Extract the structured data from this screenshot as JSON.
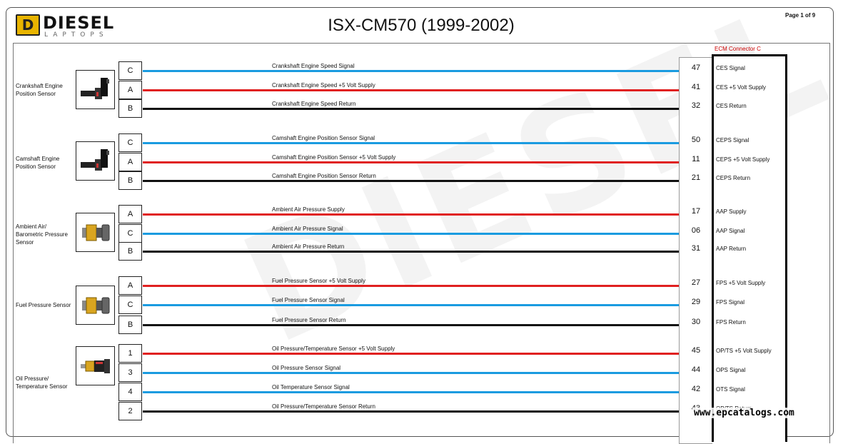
{
  "header": {
    "logo_word": "DIESEL",
    "logo_sub": "LAPTOPS",
    "logo_mark": "D",
    "title": "ISX-CM570 (1999-2002)",
    "page": "Page 1 of 9"
  },
  "ecm": {
    "label": "ECM Connector C"
  },
  "colors": {
    "blue": "#1a9be0",
    "red": "#e02020",
    "black": "#111111",
    "ecm_label": "#cc0000"
  },
  "sensors": [
    {
      "name": "Crankshaft Engine Position Sensor",
      "icon": "crankshaft-sensor-icon",
      "wires": [
        {
          "letter": "C",
          "color": "blue",
          "label": "Crankshaft Engine Speed Signal",
          "pin": "47",
          "signal": "CES Signal"
        },
        {
          "letter": "A",
          "color": "red",
          "label": "Crankshaft Engine Speed +5 Volt Supply",
          "pin": "41",
          "signal": "CES +5 Volt Supply"
        },
        {
          "letter": "B",
          "color": "black",
          "label": "Crankshaft Engine Speed Return",
          "pin": "32",
          "signal": "CES Return"
        }
      ]
    },
    {
      "name": "Camshaft Engine Position Sensor",
      "icon": "camshaft-sensor-icon",
      "wires": [
        {
          "letter": "C",
          "color": "blue",
          "label": "Camshaft Engine Position Sensor Signal",
          "pin": "50",
          "signal": "CEPS Signal"
        },
        {
          "letter": "A",
          "color": "red",
          "label": "Camshaft Engine Position Sensor +5 Volt Supply",
          "pin": "11",
          "signal": "CEPS +5 Volt Supply"
        },
        {
          "letter": "B",
          "color": "black",
          "label": "Camshaft Engine Position Sensor Return",
          "pin": "21",
          "signal": "CEPS Return"
        }
      ]
    },
    {
      "name": "Ambient Air/ Barometric Pressure Sensor",
      "icon": "pressure-sensor-icon",
      "wires": [
        {
          "letter": "A",
          "color": "red",
          "label": "Ambient Air Pressure Supply",
          "pin": "17",
          "signal": "AAP Supply"
        },
        {
          "letter": "C",
          "color": "blue",
          "label": "Ambient Air Pressure Signal",
          "pin": "06",
          "signal": "AAP Signal"
        },
        {
          "letter": "B",
          "color": "black",
          "label": "Ambient Air Pressure Return",
          "pin": "31",
          "signal": "AAP Return"
        }
      ]
    },
    {
      "name": "Fuel Pressure Sensor",
      "icon": "pressure-sensor-icon",
      "wires": [
        {
          "letter": "A",
          "color": "red",
          "label": "Fuel Pressure Sensor +5 Volt Supply",
          "pin": "27",
          "signal": "FPS +5 Volt Supply"
        },
        {
          "letter": "C",
          "color": "blue",
          "label": "Fuel Pressure Sensor Signal",
          "pin": "29",
          "signal": "FPS Signal"
        },
        {
          "letter": "B",
          "color": "black",
          "label": "Fuel Pressure Sensor Return",
          "pin": "30",
          "signal": "FPS Return"
        }
      ]
    },
    {
      "name": "Oil Pressure/ Temperature Sensor",
      "icon": "oil-sensor-icon",
      "wires": [
        {
          "letter": "1",
          "color": "red",
          "label": "Oil Pressure/Temperature Sensor +5 Volt Supply",
          "pin": "45",
          "signal": "OP/TS +5 Volt Supply"
        },
        {
          "letter": "3",
          "color": "blue",
          "label": "Oil Pressure Sensor Signal",
          "pin": "44",
          "signal": "OPS Signal"
        },
        {
          "letter": "4",
          "color": "blue",
          "label": "Oil Temperature Sensor Signal",
          "pin": "42",
          "signal": "OTS Signal"
        },
        {
          "letter": "2",
          "color": "black",
          "label": "Oil Pressure/Temperature Sensor Return",
          "pin": "43",
          "signal": "OP/TS Return"
        }
      ]
    }
  ],
  "footer": {
    "watermark_url": "www.epcatalogs.com"
  }
}
